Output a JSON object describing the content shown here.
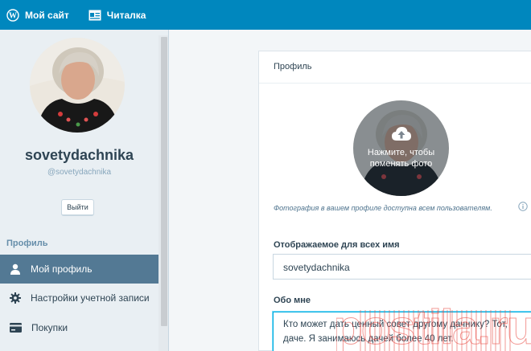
{
  "topbar": {
    "my_site_label": "Мой сайт",
    "reader_label": "Читалка",
    "color": "#0087be"
  },
  "sidebar": {
    "username": "sovetydachnika",
    "handle": "@sovetydachnika",
    "logout_label": "Выйти",
    "section_label": "Профиль",
    "items": [
      {
        "label": "Мой профиль",
        "icon": "person-icon",
        "active": true
      },
      {
        "label": "Настройки учетной записи",
        "icon": "gear-icon",
        "active": false
      },
      {
        "label": "Покупки",
        "icon": "credit-card-icon",
        "active": false
      }
    ]
  },
  "profile": {
    "header": "Профиль",
    "avatar_overlay": "Нажмите, чтобы поменять фото",
    "photo_note": "Фотография в вашем профиле доступна всем пользователям.",
    "display_name_label": "Отображаемое для всех имя",
    "display_name_value": "sovetydachnika",
    "about_label": "Обо мне",
    "about_value": "Кто может дать ценный совет другому дачнику? Тот,\nдаче. Я занимаюсь дачей более 40 лет."
  },
  "watermark": {
    "text": "postila.ru",
    "color": "#e8463e"
  }
}
